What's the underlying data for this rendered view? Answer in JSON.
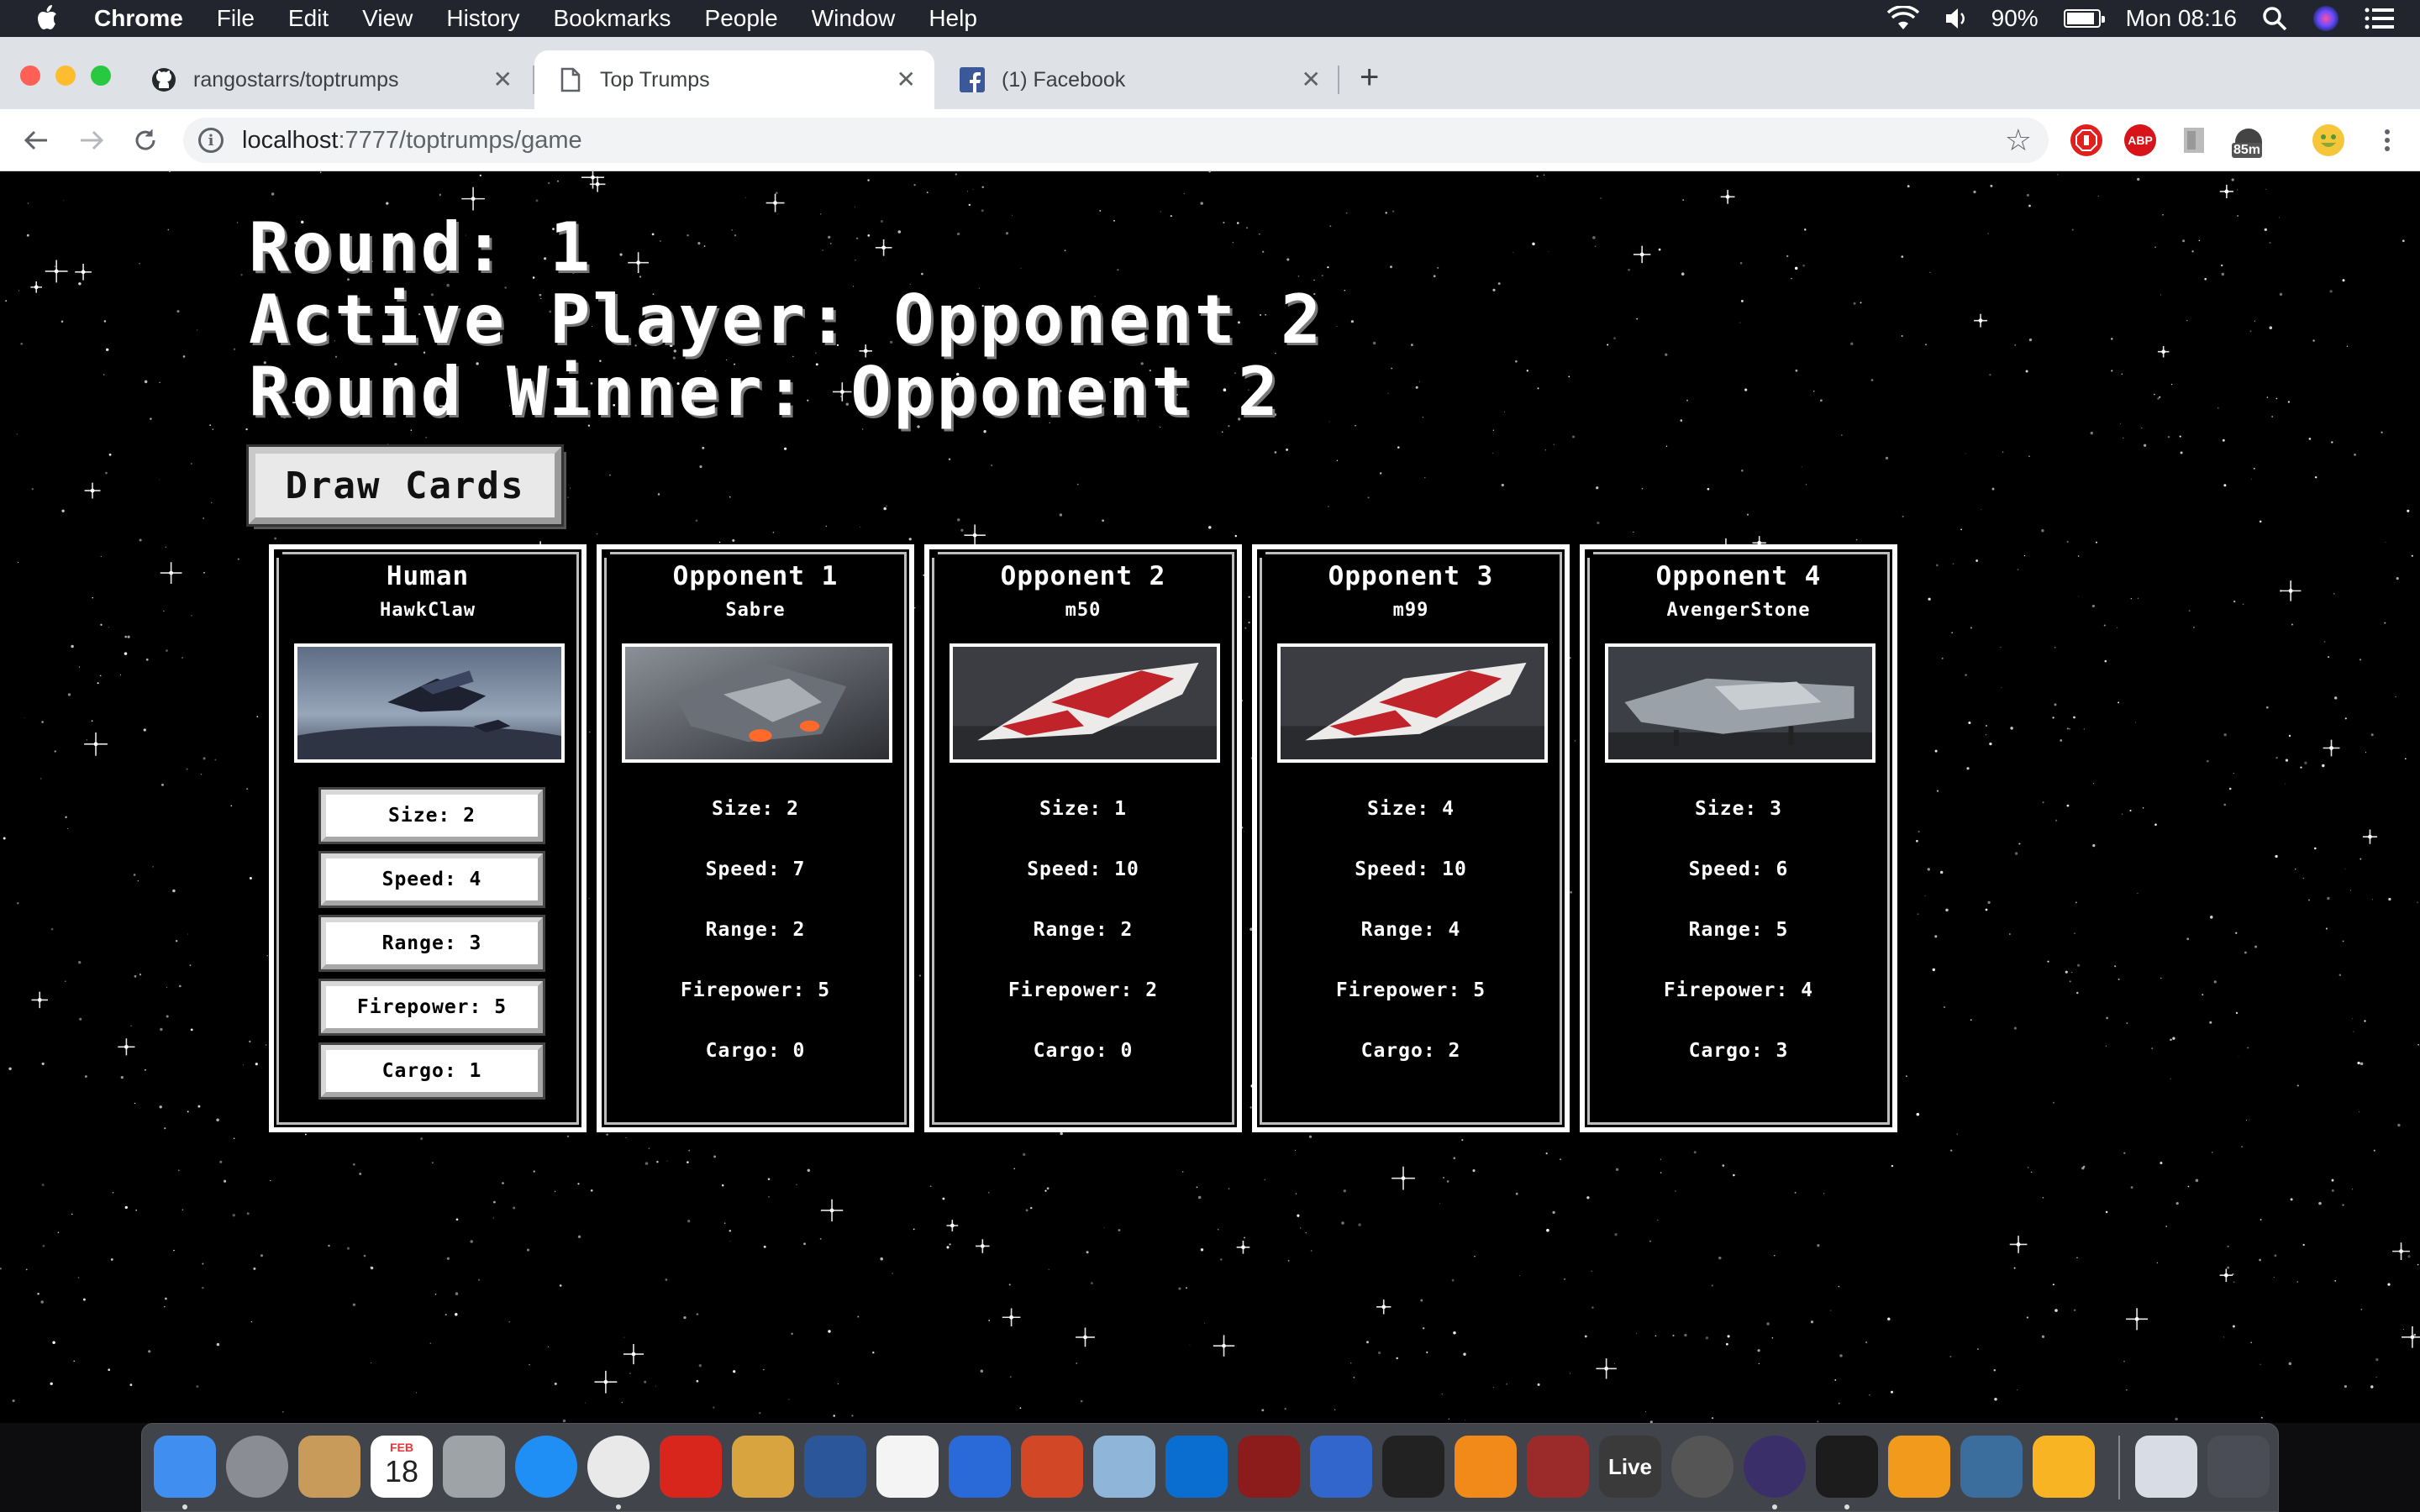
{
  "menubar": {
    "app": "Chrome",
    "items": [
      "File",
      "Edit",
      "View",
      "History",
      "Bookmarks",
      "People",
      "Window",
      "Help"
    ],
    "battery_percent": "90%",
    "battery_level": 0.9,
    "clock": "Mon 08:16"
  },
  "browser": {
    "tabs": [
      {
        "title": "rangostarrs/toptrumps",
        "icon": "github-icon"
      },
      {
        "title": "Top Trumps",
        "icon": "document-icon"
      },
      {
        "title": "(1) Facebook",
        "icon": "facebook-icon"
      }
    ],
    "url_host": "localhost",
    "url_rest": ":7777/toptrumps/game",
    "extensions": [
      "adblock-icon",
      "abp-icon",
      "document-icon",
      "timer-icon",
      "emoji-icon"
    ],
    "timer_badge": "85m",
    "abp_label": "ABP"
  },
  "game": {
    "round_label": "Round:",
    "round": "1",
    "active_label": "Active Player:",
    "active_player": "Opponent 2",
    "winner_label": "Round Winner:",
    "round_winner": "Opponent 2",
    "draw_button": "Draw Cards"
  },
  "cards": [
    {
      "player": "Human",
      "ship": "HawkClaw",
      "image": "hawkclaw-ship-image",
      "stats": [
        "Size: 2",
        "Speed: 4",
        "Range: 3",
        "Firepower: 5",
        "Cargo: 1"
      ]
    },
    {
      "player": "Opponent 1",
      "ship": "Sabre",
      "image": "sabre-ship-image",
      "stats": [
        "Size: 2",
        "Speed: 7",
        "Range: 2",
        "Firepower: 5",
        "Cargo: 0"
      ]
    },
    {
      "player": "Opponent 2",
      "ship": "m50",
      "image": "m50-ship-image",
      "stats": [
        "Size: 1",
        "Speed: 10",
        "Range: 2",
        "Firepower: 2",
        "Cargo: 0"
      ]
    },
    {
      "player": "Opponent 3",
      "ship": "m99",
      "image": "m99-ship-image",
      "stats": [
        "Size: 4",
        "Speed: 10",
        "Range: 4",
        "Firepower: 5",
        "Cargo: 2"
      ]
    },
    {
      "player": "Opponent 4",
      "ship": "AvengerStone",
      "image": "avengerstone-ship-image",
      "stats": [
        "Size: 3",
        "Speed: 6",
        "Range: 5",
        "Firepower: 4",
        "Cargo: 3"
      ]
    }
  ],
  "dock": {
    "calendar_month": "FEB",
    "calendar_day": "18",
    "live_label": "Live",
    "apps": [
      "finder-icon",
      "system-preferences-icon",
      "archive-utility-icon",
      "calendar-icon",
      "calculator-icon",
      "safari-icon",
      "chrome-icon",
      "acrobat-icon",
      "preview-icon",
      "word-icon",
      "textedit-icon",
      "keynote-icon",
      "powerpoint-icon",
      "preview-bird-icon",
      "outlook-icon",
      "dictionary-icon",
      "flag-app-icon",
      "fox-app-icon",
      "vlc-icon",
      "photo-booth-icon",
      "live-app-icon",
      "git-app-icon",
      "eclipse-icon",
      "terminal-icon",
      "sublime-text-icon",
      "postgres-icon",
      "sketch-icon",
      "documents-folder-icon",
      "trash-icon"
    ]
  }
}
